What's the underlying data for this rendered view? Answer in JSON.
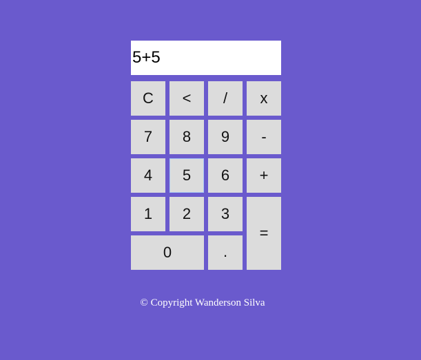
{
  "display": {
    "value": "5+5"
  },
  "keys": {
    "clear": "C",
    "backspace": "<",
    "divide": "/",
    "multiply": "x",
    "seven": "7",
    "eight": "8",
    "nine": "9",
    "minus": "-",
    "four": "4",
    "five": "5",
    "six": "6",
    "plus": "+",
    "one": "1",
    "two": "2",
    "three": "3",
    "equals": "=",
    "zero": "0",
    "dot": "."
  },
  "footer": {
    "text": "© Copyright Wanderson Silva"
  },
  "colors": {
    "background": "#6a5acd",
    "key_background": "#dcdcdc",
    "display_background": "#ffffff",
    "footer_text": "#ffffff"
  }
}
